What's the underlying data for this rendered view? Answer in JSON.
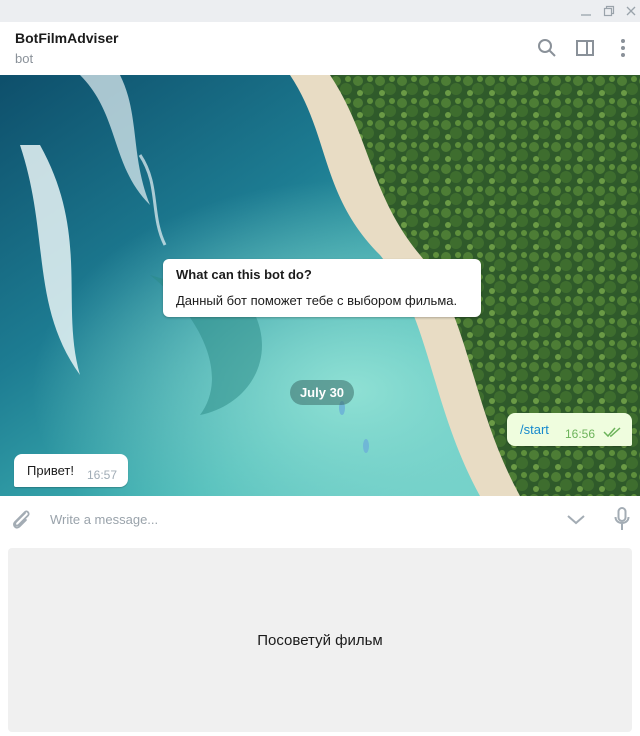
{
  "window": {
    "minimize_icon": "minimize-icon",
    "restore_icon": "restore-icon",
    "close_icon": "close-icon"
  },
  "header": {
    "name": "BotFilmAdviser",
    "status": "bot",
    "icons": [
      "search-icon",
      "sidebar-icon",
      "more-vertical-icon"
    ]
  },
  "chat": {
    "bot_info": {
      "title": "What can this bot do?",
      "text": "Данный бот поможет тебе с выбором фильма."
    },
    "date": "July 30",
    "messages": [
      {
        "direction": "out",
        "text": "/start",
        "time": "16:56",
        "status": "read"
      },
      {
        "direction": "in",
        "text": "Привет!",
        "time": "16:57"
      }
    ]
  },
  "composer": {
    "placeholder": "Write a message...",
    "value": ""
  },
  "reply_keyboard": {
    "buttons": [
      "Посоветуй фильм"
    ]
  },
  "colors": {
    "outgoing_bubble": "#effdde",
    "link": "#168acd",
    "read_check": "#6cb35a",
    "keyboard_button": "#f0f0f0"
  }
}
